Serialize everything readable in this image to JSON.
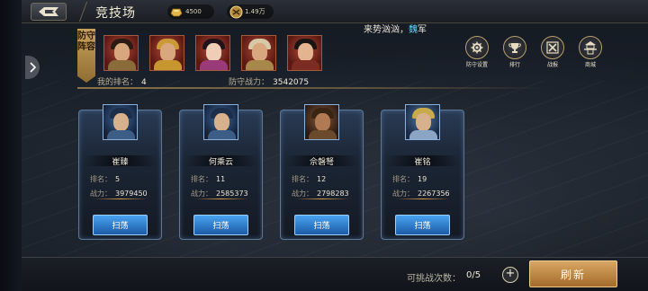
{
  "header": {
    "title": "竞技场",
    "resources": [
      {
        "icon": "gold-ingot-icon",
        "value": "4500"
      },
      {
        "icon": "coin-emblem-icon",
        "value": "1.49万"
      }
    ]
  },
  "marquee": {
    "prefix": "来势汹汹，",
    "highlight": "魏",
    "suffix": "军"
  },
  "defense": {
    "label_top": "防守",
    "label_bottom": "阵容",
    "rank_label": "我的排名：",
    "rank_value": "4",
    "power_label": "防守战力：",
    "power_value": "3542075",
    "heroes": [
      "hero-1",
      "hero-2",
      "hero-3",
      "hero-4",
      "hero-5"
    ]
  },
  "functions": [
    {
      "icon": "gear-icon",
      "label": "防守设置"
    },
    {
      "icon": "trophy-icon",
      "label": "排行"
    },
    {
      "icon": "crossed-swords-icon",
      "label": "战报"
    },
    {
      "icon": "pagoda-icon",
      "label": "商城"
    }
  ],
  "opponents": [
    {
      "name": "崔臻",
      "rank_label": "排名：",
      "rank": "5",
      "power_label": "战力：",
      "power": "3979450",
      "button": "扫荡"
    },
    {
      "name": "何乘云",
      "rank_label": "排名：",
      "rank": "11",
      "power_label": "战力：",
      "power": "2585373",
      "button": "扫荡"
    },
    {
      "name": "佘磐弩",
      "rank_label": "排名：",
      "rank": "12",
      "power_label": "战力：",
      "power": "2798283",
      "button": "扫荡"
    },
    {
      "name": "崔铭",
      "rank_label": "排名：",
      "rank": "19",
      "power_label": "战力：",
      "power": "2267356",
      "button": "扫荡"
    }
  ],
  "footer": {
    "chance_label": "可挑战次数：",
    "chance_value": "0/5",
    "plus": "+",
    "refresh": "刷新"
  }
}
